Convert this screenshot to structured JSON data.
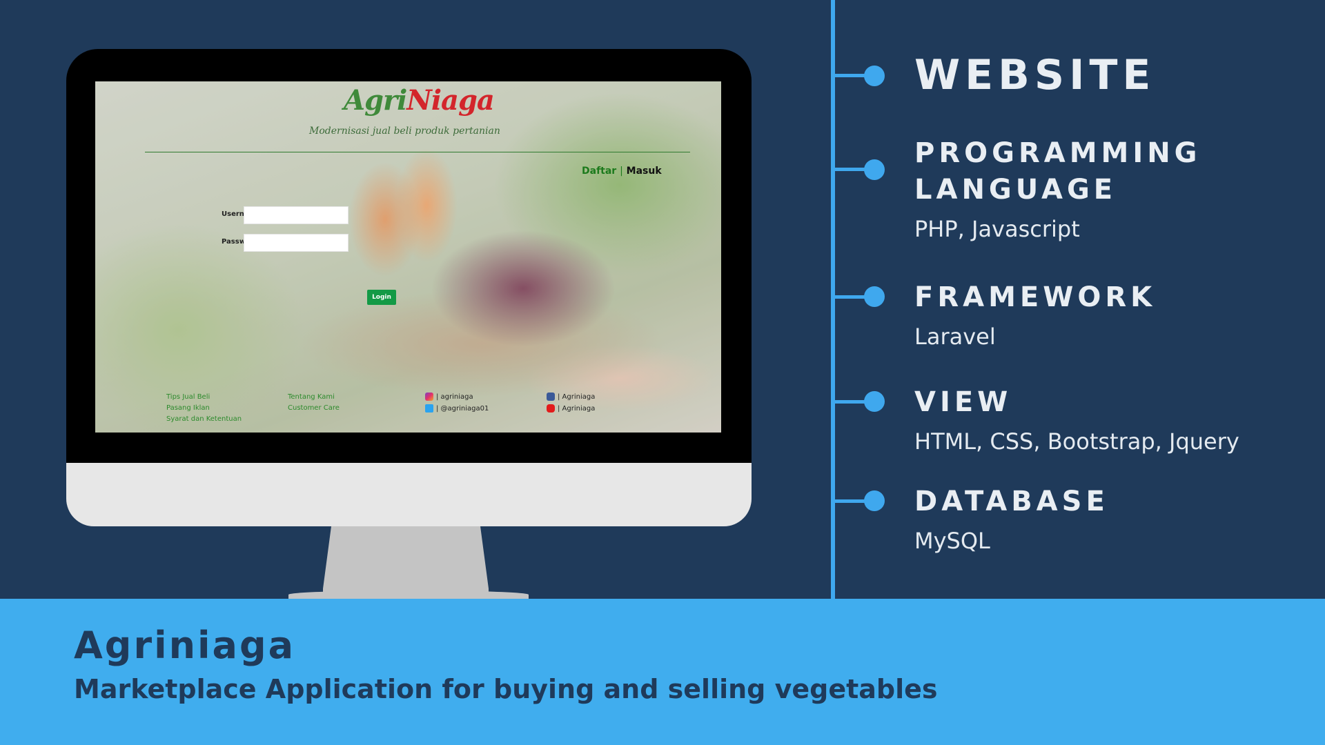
{
  "site": {
    "logo_part1": "Agri",
    "logo_part2": "Niaga",
    "tagline": "Modernisasi jual beli produk pertanian",
    "nav": {
      "register": "Daftar",
      "separator": "|",
      "login": "Masuk"
    },
    "login_form": {
      "username_label": "Username",
      "password_label": "Password",
      "submit_label": "Login"
    },
    "footer": {
      "col1": [
        "Tips Jual Beli",
        "Pasang Iklan",
        "Syarat dan Ketentuan"
      ],
      "col2": [
        "Tentang Kami",
        "Customer Care"
      ],
      "social": {
        "instagram": "| agriniaga",
        "twitter": "| @agriniaga01",
        "facebook": "| Agriniaga",
        "youtube": "| Agriniaga"
      }
    }
  },
  "info": {
    "website": "WEBSITE",
    "programming_line1": "PROGRAMMING",
    "programming_line2": "LANGUAGE",
    "programming_value": "PHP, Javascript",
    "framework": "FRAMEWORK",
    "framework_value": "Laravel",
    "view": "VIEW",
    "view_value": "HTML, CSS, Bootstrap, Jquery",
    "database": "DATABASE",
    "database_value": "MySQL"
  },
  "banner": {
    "title": "Agriniaga",
    "subtitle": "Marketplace Application for buying and selling vegetables"
  },
  "colors": {
    "background": "#1f3a5a",
    "accent": "#40adee",
    "brand_green": "#3f8a3a",
    "brand_red": "#d3252b"
  }
}
